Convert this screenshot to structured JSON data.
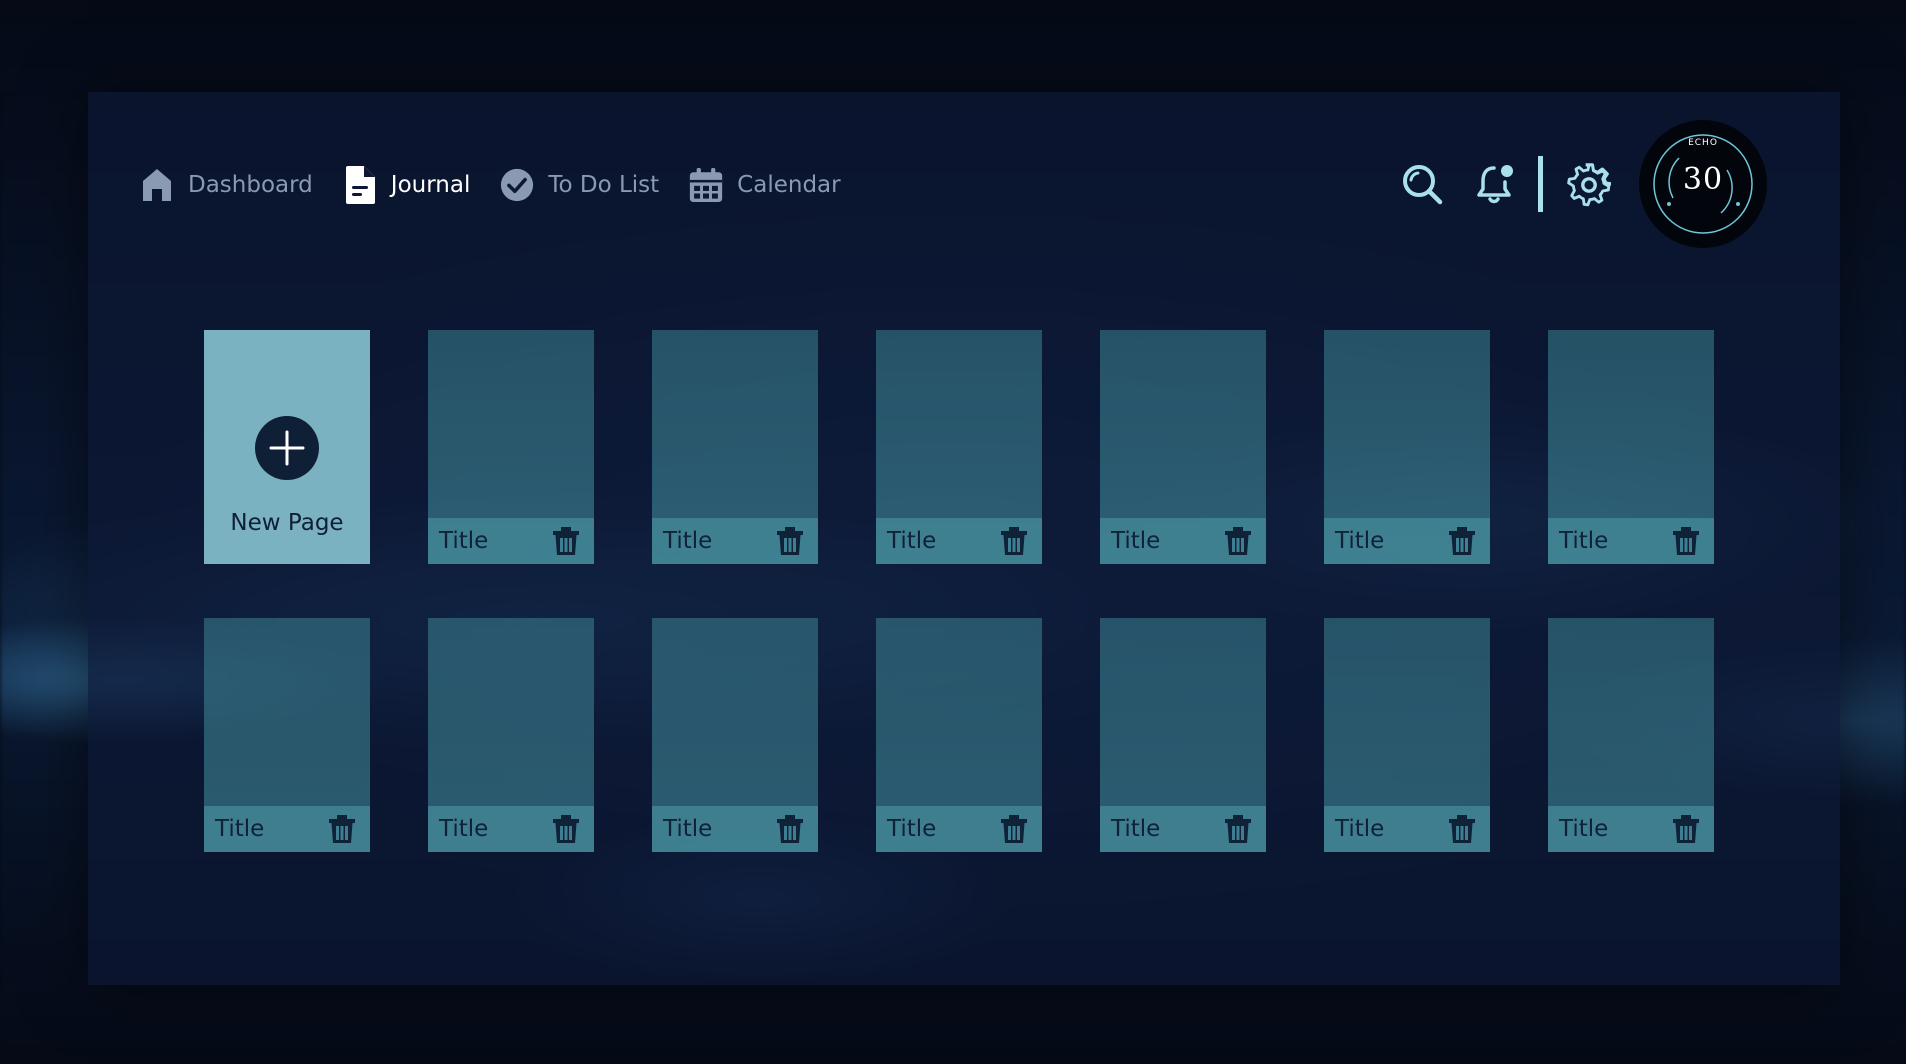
{
  "nav": {
    "items": [
      {
        "label": "Dashboard",
        "icon": "home-icon",
        "active": false
      },
      {
        "label": "Journal",
        "icon": "document-icon",
        "active": true
      },
      {
        "label": "To Do List",
        "icon": "check-circle-icon",
        "active": false
      },
      {
        "label": "Calendar",
        "icon": "calendar-icon",
        "active": false
      }
    ]
  },
  "tools": {
    "search_icon": "search-icon",
    "bell_icon": "bell-icon",
    "gear_icon": "gear-icon",
    "accent_color": "#a8e0ec"
  },
  "echo": {
    "label": "ECHO",
    "value": "30"
  },
  "journal": {
    "new_page_label": "New Page",
    "cards": [
      {
        "title": "Title"
      },
      {
        "title": "Title"
      },
      {
        "title": "Title"
      },
      {
        "title": "Title"
      },
      {
        "title": "Title"
      },
      {
        "title": "Title"
      },
      {
        "title": "Title"
      },
      {
        "title": "Title"
      },
      {
        "title": "Title"
      },
      {
        "title": "Title"
      },
      {
        "title": "Title"
      },
      {
        "title": "Title"
      },
      {
        "title": "Title"
      }
    ]
  },
  "colors": {
    "new_card": "#7ab2c2",
    "card_text": "#0f2238",
    "nav_inactive": "#8a9ab0",
    "nav_active": "#ffffff"
  }
}
